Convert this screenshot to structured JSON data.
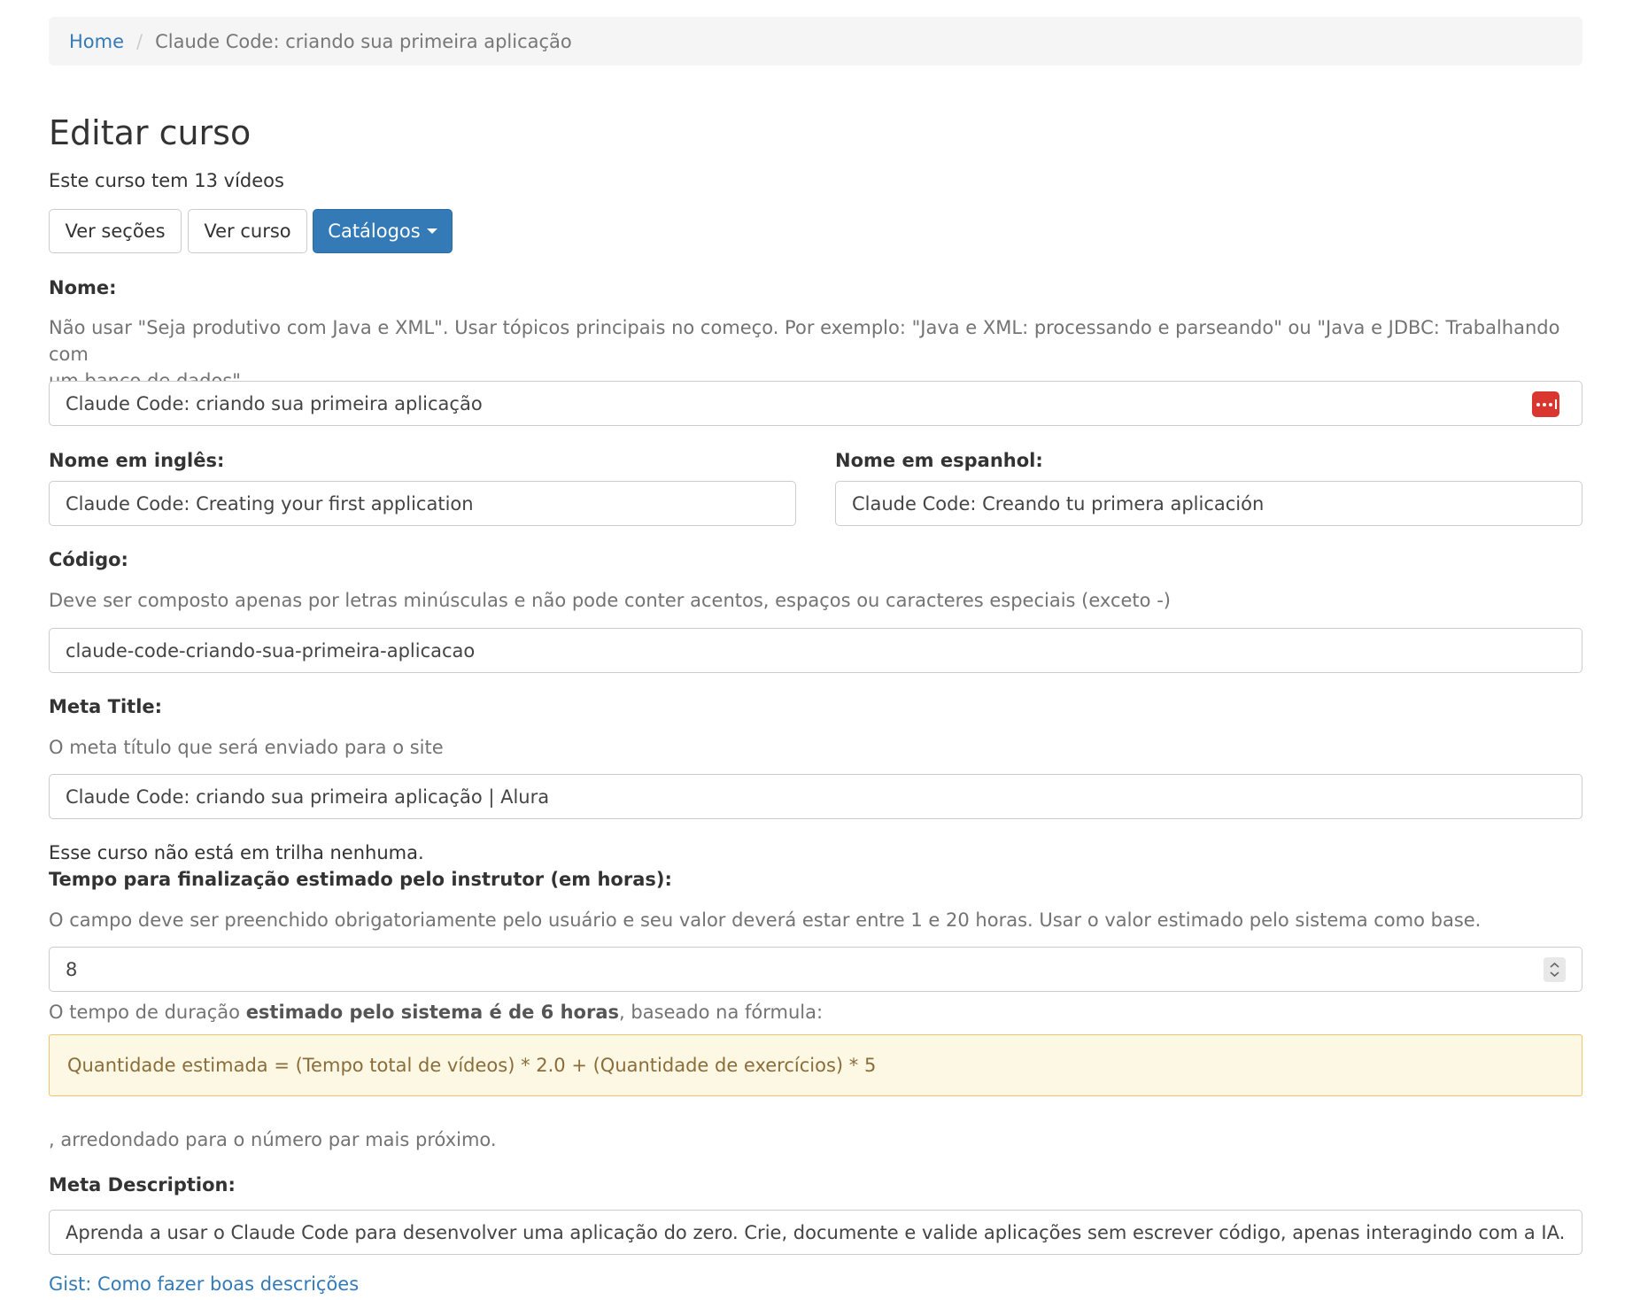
{
  "breadcrumb": {
    "home": "Home",
    "separator": "/",
    "current": "Claude Code: criando sua primeira aplicação"
  },
  "page_title": "Editar curso",
  "course_info": "Este curso tem 13 vídeos",
  "buttons": {
    "sections": "Ver seções",
    "view_course": "Ver curso",
    "catalogs": "Catálogos"
  },
  "fields": {
    "name": {
      "label": "Nome:",
      "help_line1": "Não usar \"Seja produtivo com Java e XML\". Usar tópicos principais no começo. Por exemplo: \"Java e XML: processando e parseando\" ou \"Java e JDBC: Trabalhando com",
      "help_line2": "um banco de dados\".",
      "value": "Claude Code: criando sua primeira aplicação",
      "icon": "password-manager-icon"
    },
    "name_en": {
      "label": "Nome em inglês:",
      "value": "Claude Code: Creating your first application"
    },
    "name_es": {
      "label": "Nome em espanhol:",
      "value": "Claude Code: Creando tu primera aplicación"
    },
    "code": {
      "label": "Código:",
      "help": "Deve ser composto apenas por letras minúsculas e não pode conter acentos, espaços ou caracteres especiais (exceto -)",
      "value": "claude-code-criando-sua-primeira-aplicacao"
    },
    "meta_title": {
      "label": "Meta Title:",
      "help": "O meta título que será enviado para o site",
      "value": "Claude Code: criando sua primeira aplicação | Alura"
    },
    "track_info": "Esse curso não está em trilha nenhuma.",
    "estimated_time": {
      "label": "Tempo para finalização estimado pelo instrutor (em horas):",
      "help": "O campo deve ser preenchido obrigatoriamente pelo usuário e seu valor deverá estar entre 1 e 20 horas. Usar o valor estimado pelo sistema como base.",
      "value": "8",
      "system_prefix": "O tempo de duração ",
      "system_bold": "estimado pelo sistema é de 6 horas",
      "system_suffix": ", baseado na fórmula:",
      "formula": "Quantidade estimada = (Tempo total de vídeos) * 2.0 + (Quantidade de exercícios) * 5",
      "rounding": ", arredondado para o número par mais próximo."
    },
    "meta_description": {
      "label": "Meta Description:",
      "value": "Aprenda a usar o Claude Code para desenvolver uma aplicação do zero. Crie, documente e valide aplicações sem escrever código, apenas interagindo com a IA."
    }
  },
  "gist_link": "Gist: Como fazer boas descrições",
  "colors": {
    "link": "#337ab7",
    "primary": "#337ab7",
    "alert_bg": "#fcf8e3",
    "alert_text": "#8a6d3b",
    "icon_red": "#d9362f"
  }
}
